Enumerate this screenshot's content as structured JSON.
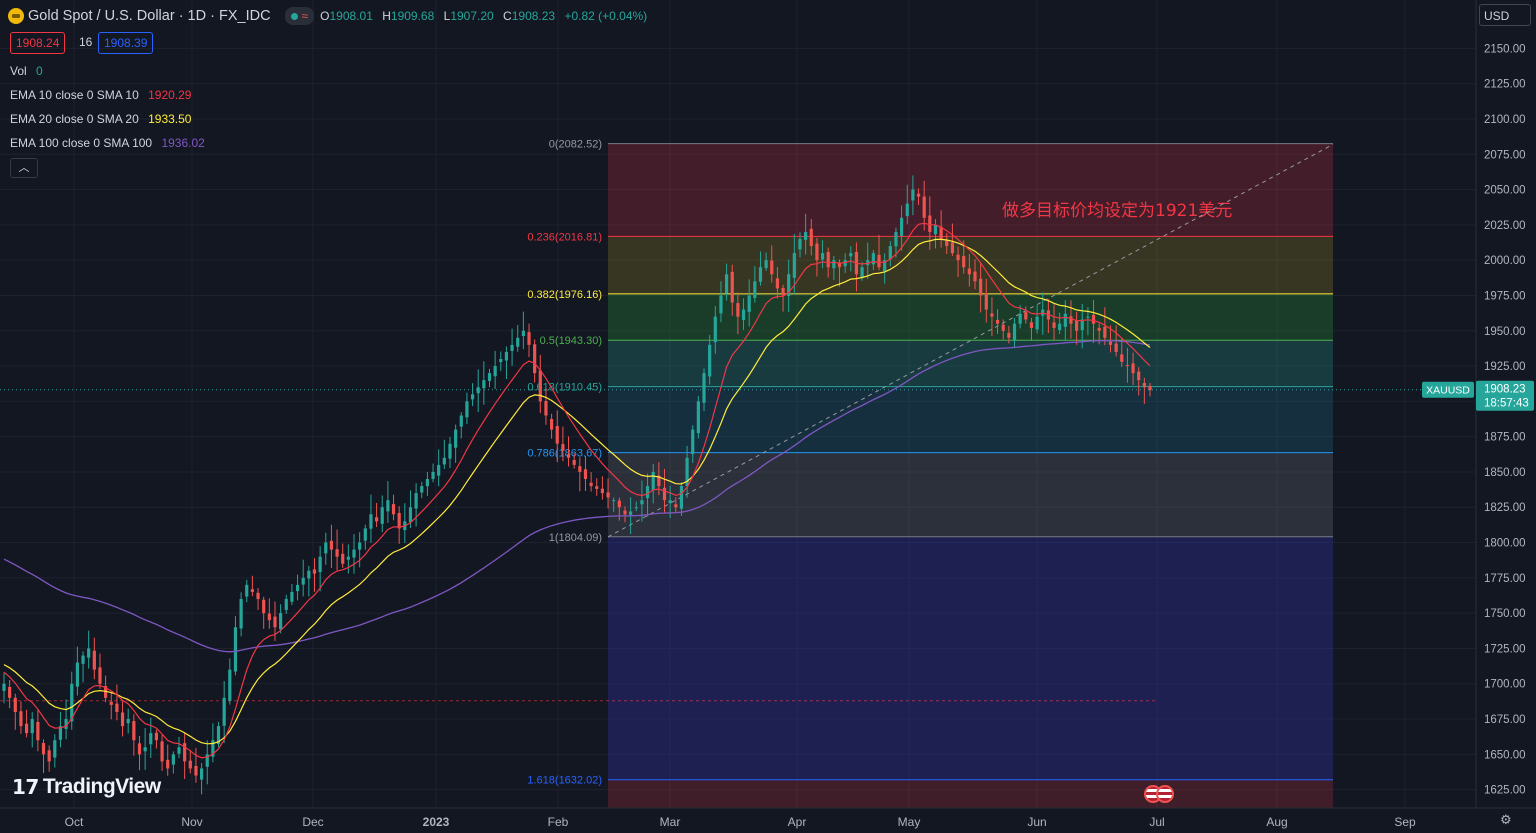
{
  "header": {
    "symbol_title": "Gold Spot / U.S. Dollar · 1D · FX_IDC",
    "ohlc": [
      {
        "k": "O",
        "v": "1908.01"
      },
      {
        "k": "H",
        "v": "1909.68"
      },
      {
        "k": "L",
        "v": "1907.20"
      },
      {
        "k": "C",
        "v": "1908.23"
      }
    ],
    "change": "+0.82 (+0.04%)",
    "bid": "1908.24",
    "spread": "16",
    "ask": "1908.39"
  },
  "indicators": {
    "vol_label": "Vol",
    "vol_value": "0",
    "ema10_label": "EMA 10 close 0 SMA 10",
    "ema10_value": "1920.29",
    "ema20_label": "EMA 20 close 0 SMA 20",
    "ema20_value": "1933.50",
    "ema100_label": "EMA 100 close 0 SMA 100",
    "ema100_value": "1936.02"
  },
  "currency_selector": "USD",
  "price_tag": {
    "symbol": "XAUUSD",
    "price": "1908.23",
    "countdown": "18:57:43"
  },
  "annotation": "做多目标价均设定为1921美元",
  "branding": "TradingView",
  "colors": {
    "up": "#26a69a",
    "down": "#ef5350",
    "ema10": "#f23645",
    "ema20": "#ffeb3b",
    "ema100": "#7e57c2",
    "bg": "#131722"
  },
  "chart_data": {
    "type": "candlestick",
    "title": "Gold Spot / U.S. Dollar · 1D · FX_IDC",
    "ylim": [
      1612,
      2163
    ],
    "y_ticks": [
      1625,
      1650,
      1675,
      1700,
      1725,
      1750,
      1775,
      1800,
      1825,
      1850,
      1875,
      1900,
      1925,
      1950,
      1975,
      2000,
      2025,
      2050,
      2075,
      2100,
      2125,
      2150
    ],
    "y_tick_labels": [
      "1625.00",
      "1650.00",
      "1675.00",
      "1700.00",
      "1725.00",
      "1750.00",
      "1775.00",
      "1800.00",
      "1825.00",
      "1850.00",
      "1875.00",
      "1900.00",
      "1925.00",
      "1950.00",
      "1975.00",
      "2000.00",
      "2025.00",
      "2050.00",
      "2075.00",
      "2100.00",
      "2125.00",
      "2150.00"
    ],
    "x_labels": [
      "Oct",
      "Nov",
      "Dec",
      "2023",
      "Feb",
      "Mar",
      "Apr",
      "May",
      "Jun",
      "Jul",
      "Aug",
      "Sep"
    ],
    "fibonacci": [
      {
        "label": "0(2082.52)",
        "price": 2082.52
      },
      {
        "label": "0.236(2016.81)",
        "price": 2016.81
      },
      {
        "label": "0.382(1976.16)",
        "price": 1976.16
      },
      {
        "label": "0.5(1943.30)",
        "price": 1943.3
      },
      {
        "label": "0.618(1910.45)",
        "price": 1910.45
      },
      {
        "label": "0.786(1863.67)",
        "price": 1863.67
      },
      {
        "label": "1(1804.09)",
        "price": 1804.09
      },
      {
        "label": "1.618(1632.02)",
        "price": 1632.02
      }
    ],
    "dashed_level": 1688,
    "last_close": 1908.23,
    "closes": [
      1700,
      1690,
      1680,
      1670,
      1665,
      1675,
      1660,
      1650,
      1645,
      1660,
      1670,
      1675,
      1700,
      1715,
      1720,
      1725,
      1710,
      1700,
      1690,
      1685,
      1680,
      1670,
      1675,
      1660,
      1650,
      1655,
      1665,
      1660,
      1645,
      1640,
      1650,
      1655,
      1645,
      1640,
      1635,
      1640,
      1650,
      1660,
      1670,
      1690,
      1710,
      1740,
      1760,
      1770,
      1765,
      1760,
      1750,
      1745,
      1740,
      1750,
      1760,
      1765,
      1770,
      1775,
      1780,
      1778,
      1790,
      1800,
      1795,
      1790,
      1785,
      1790,
      1795,
      1800,
      1810,
      1820,
      1815,
      1825,
      1830,
      1820,
      1810,
      1815,
      1825,
      1835,
      1840,
      1845,
      1850,
      1855,
      1860,
      1870,
      1880,
      1890,
      1900,
      1905,
      1910,
      1915,
      1920,
      1925,
      1930,
      1935,
      1940,
      1945,
      1950,
      1940,
      1920,
      1900,
      1890,
      1880,
      1870,
      1865,
      1860,
      1855,
      1850,
      1845,
      1840,
      1838,
      1835,
      1832,
      1830,
      1825,
      1820,
      1822,
      1825,
      1830,
      1840,
      1850,
      1840,
      1830,
      1830,
      1825,
      1840,
      1860,
      1880,
      1900,
      1920,
      1940,
      1960,
      1975,
      1990,
      1970,
      1960,
      1965,
      1975,
      1985,
      1995,
      2000,
      1990,
      1980,
      1975,
      1990,
      2005,
      2015,
      2020,
      2010,
      2000,
      2005,
      1995,
      2000,
      1995,
      2000,
      2005,
      1990,
      1995,
      2000,
      2005,
      1995,
      2000,
      2010,
      2020,
      2030,
      2040,
      2050,
      2045,
      2030,
      2020,
      2025,
      2015,
      2010,
      2005,
      2000,
      1995,
      1990,
      1985,
      1975,
      1965,
      1960,
      1955,
      1950,
      1945,
      1955,
      1962,
      1958,
      1952,
      1960,
      1965,
      1958,
      1952,
      1955,
      1962,
      1955,
      1950,
      1958,
      1960,
      1955,
      1950,
      1945,
      1940,
      1935,
      1928,
      1925,
      1920,
      1915,
      1910,
      1908
    ],
    "ema10_last": 1920.29,
    "ema20_last": 1933.5,
    "ema100_last": 1936.02
  }
}
